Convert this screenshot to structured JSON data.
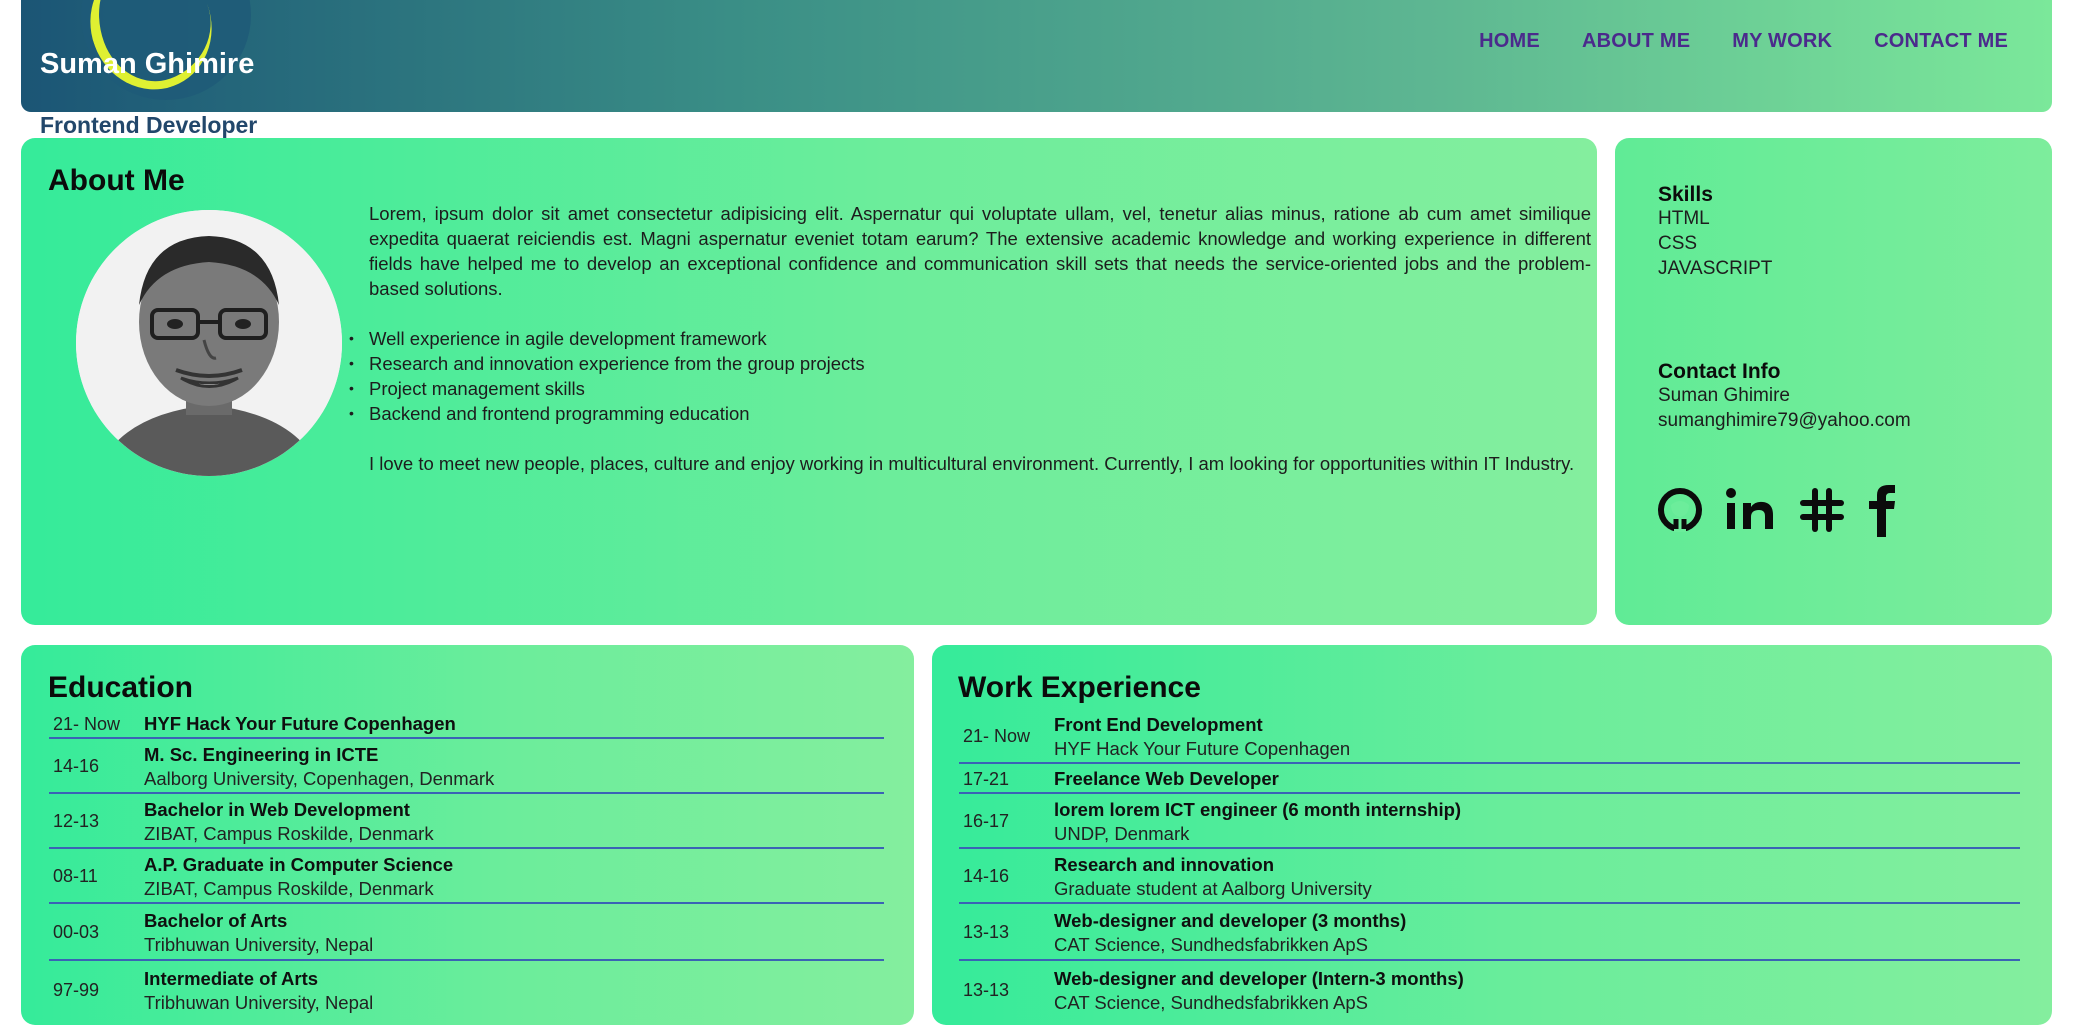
{
  "header": {
    "name": "Suman Ghimire",
    "subtitle": "Frontend Developer",
    "nav": [
      "HOME",
      "ABOUT ME",
      "MY WORK",
      "CONTACT ME"
    ]
  },
  "about": {
    "title": "About Me",
    "intro": "Lorem, ipsum dolor sit amet consectetur adipisicing elit. Aspernatur qui voluptate ullam, vel, tenetur alias minus, ratione ab cum amet similique expedita quaerat reiciendis est. Magni aspernatur eveniet totam earum? The extensive academic knowledge and working experience in different fields have helped me to develop an exceptional confidence and communication skill sets that needs the service-oriented jobs and the problem-based solutions.",
    "bullets": [
      "Well experience in agile development framework",
      "Research and innovation experience from the group projects",
      "Project management skills",
      "Backend and frontend programming education"
    ],
    "outro": "I love to meet new people, places, culture and enjoy working in multicultural environment. Currently, I am looking for opportunities within IT Industry."
  },
  "skills": {
    "title": "Skills",
    "items": [
      "HTML",
      "CSS",
      "JAVASCRIPT"
    ]
  },
  "contact": {
    "title": "Contact Info",
    "name": "Suman Ghimire",
    "email": "sumanghimire79@yahoo.com"
  },
  "socials": [
    "github-icon",
    "linkedin-icon",
    "slack-icon",
    "facebook-icon"
  ],
  "education": {
    "title": "Education",
    "rows": [
      {
        "years": "21- Now",
        "title": "HYF Hack Your Future Copenhagen",
        "sub": ""
      },
      {
        "years": "14-16",
        "title": "M. Sc. Engineering in ICTE",
        "sub": "Aalborg University, Copenhagen, Denmark"
      },
      {
        "years": "12-13",
        "title": "Bachelor in Web Development",
        "sub": "ZIBAT, Campus Roskilde, Denmark"
      },
      {
        "years": "08-11",
        "title": "A.P. Graduate in Computer Science",
        "sub": "ZIBAT, Campus Roskilde, Denmark"
      },
      {
        "years": "00-03",
        "title": "Bachelor of Arts",
        "sub": "Tribhuwan University, Nepal"
      },
      {
        "years": "97-99",
        "title": "Intermediate of Arts",
        "sub": "Tribhuwan University, Nepal"
      }
    ]
  },
  "work": {
    "title": "Work Experience",
    "rows": [
      {
        "years": "21- Now",
        "title": "Front End Development",
        "sub": "HYF Hack Your Future Copenhagen"
      },
      {
        "years": "17-21",
        "title": "Freelance Web Developer",
        "sub": ""
      },
      {
        "years": "16-17",
        "title": "lorem lorem ICT engineer (6 month internship)",
        "sub": "UNDP, Denmark"
      },
      {
        "years": "14-16",
        "title": "Research and innovation",
        "sub": "Graduate student at Aalborg University"
      },
      {
        "years": "13-13",
        "title": "Web-designer and developer (3 months)",
        "sub": "CAT Science, Sundhedsfabrikken ApS"
      },
      {
        "years": "13-13",
        "title": "Web-designer and developer (Intern-3 months)",
        "sub": "CAT Science, Sundhedsfabrikken ApS"
      }
    ]
  },
  "colors": {
    "nav": "#4b2a8c",
    "row_divider": "#3a63b5",
    "card_green": "#35eb9a"
  }
}
